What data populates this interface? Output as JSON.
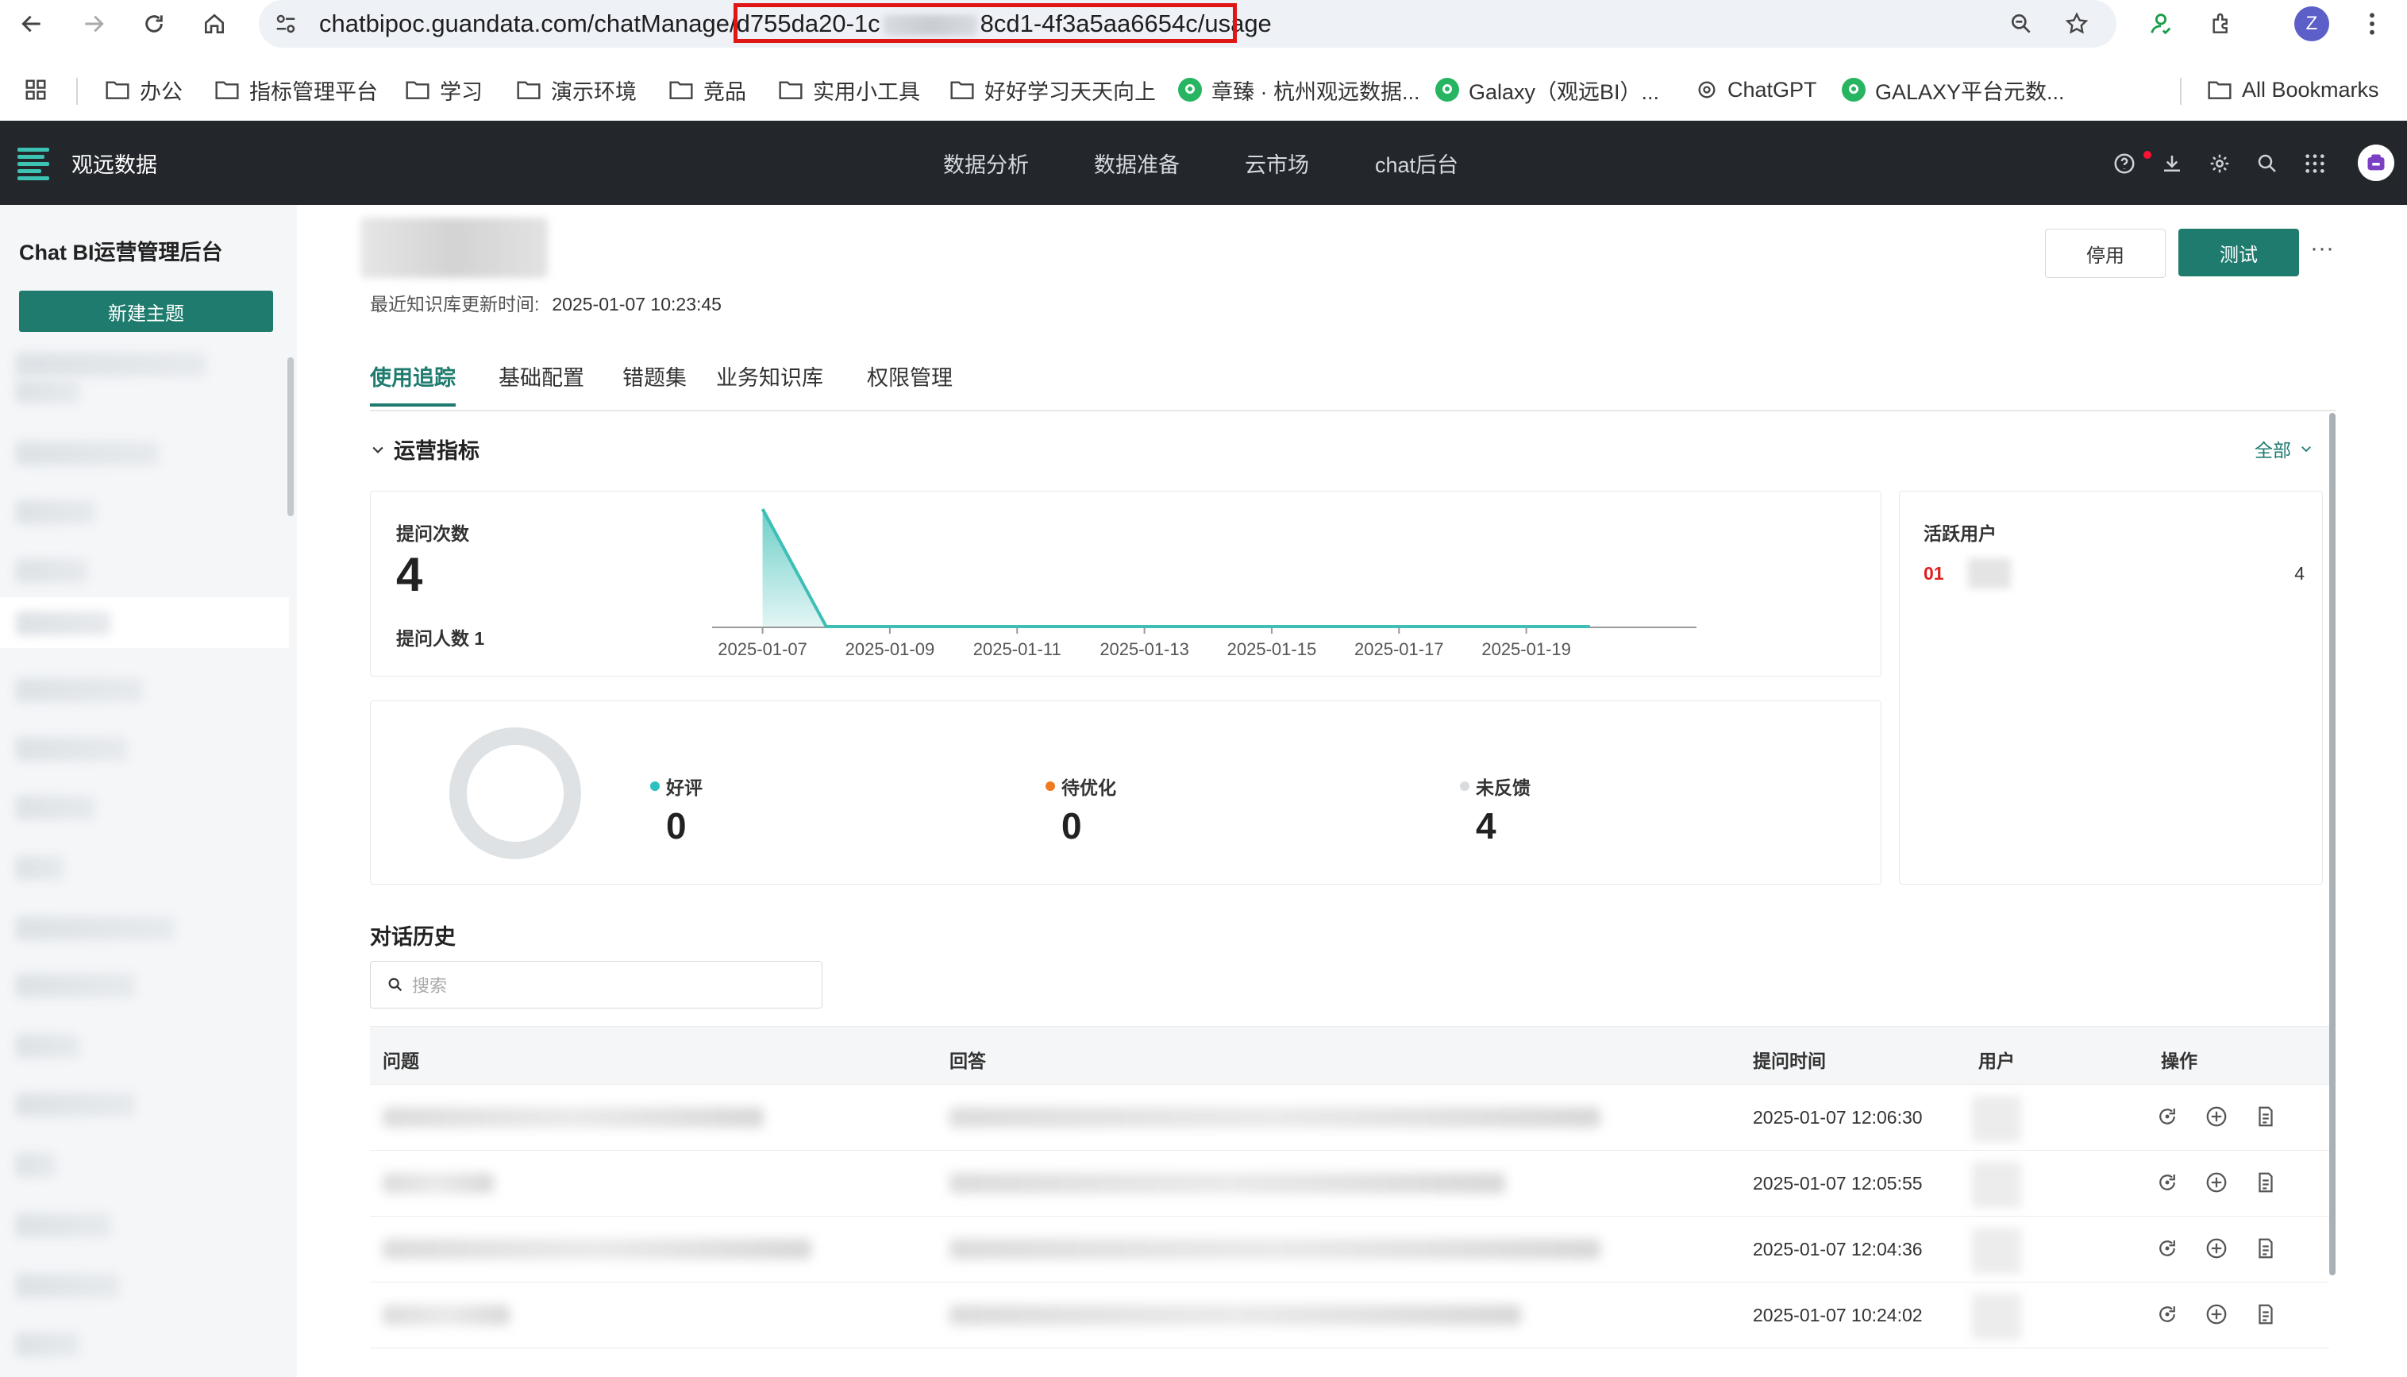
{
  "browser": {
    "url_prefix": "chatbipoc.guandata.com/chatManage/",
    "url_part1": "d755da20-1c",
    "url_part2": "8cd1-4f3a5aa6654c",
    "url_suffix": "/usage",
    "bookmarks": [
      "办公",
      "指标管理平台",
      "学习",
      "演示环境",
      "竞品",
      "实用小工具",
      "好好学习天天向上",
      "章臻 · 杭州观远数据...",
      "Galaxy（观远BI）...",
      "ChatGPT",
      "GALAXY平台元数...",
      "All Bookmarks"
    ],
    "profile_initial": "Z"
  },
  "app": {
    "brand": "观远数据",
    "nav": [
      "数据分析",
      "数据准备",
      "云市场",
      "chat后台"
    ]
  },
  "sidebar": {
    "title": "Chat BI运营管理后台",
    "new_button": "新建主题"
  },
  "header": {
    "updated_label": "最近知识库更新时间:",
    "updated_value": "2025-01-07 10:23:45",
    "stop_button": "停用",
    "test_button": "测试",
    "more": "···"
  },
  "tabs": [
    "使用追踪",
    "基础配置",
    "错题集",
    "业务知识库",
    "权限管理"
  ],
  "metrics": {
    "section_title": "运营指标",
    "filter_label": "全部",
    "questions_label": "提问次数",
    "questions_value": "4",
    "askers_label": "提问人数 1",
    "active_users_title": "活跃用户",
    "active_rank": "01",
    "active_count": "4"
  },
  "chart_data": {
    "type": "area",
    "x": [
      "2025-01-07",
      "2025-01-08",
      "2025-01-09",
      "2025-01-10",
      "2025-01-11",
      "2025-01-12",
      "2025-01-13",
      "2025-01-14",
      "2025-01-15",
      "2025-01-16",
      "2025-01-17",
      "2025-01-18",
      "2025-01-19",
      "2025-01-20"
    ],
    "tick_labels": [
      "2025-01-07",
      "2025-01-09",
      "2025-01-11",
      "2025-01-13",
      "2025-01-15",
      "2025-01-17",
      "2025-01-19"
    ],
    "values": [
      4,
      0,
      0,
      0,
      0,
      0,
      0,
      0,
      0,
      0,
      0,
      0,
      0,
      0
    ],
    "ylim": [
      0,
      4
    ],
    "color": "#3dbfb6"
  },
  "feedback": {
    "good_label": "好评",
    "good_value": "0",
    "good_color": "#2fc0c0",
    "opt_label": "待优化",
    "opt_value": "0",
    "opt_color": "#f07a22",
    "none_label": "未反馈",
    "none_value": "4",
    "none_color": "#d9dcde"
  },
  "history": {
    "title": "对话历史",
    "search_placeholder": "搜索",
    "columns": [
      "问题",
      "回答",
      "提问时间",
      "用户",
      "操作"
    ],
    "rows": [
      {
        "time": "2025-01-07 12:06:30"
      },
      {
        "time": "2025-01-07 12:05:55"
      },
      {
        "time": "2025-01-07 12:04:36"
      },
      {
        "time": "2025-01-07 10:24:02"
      }
    ]
  }
}
